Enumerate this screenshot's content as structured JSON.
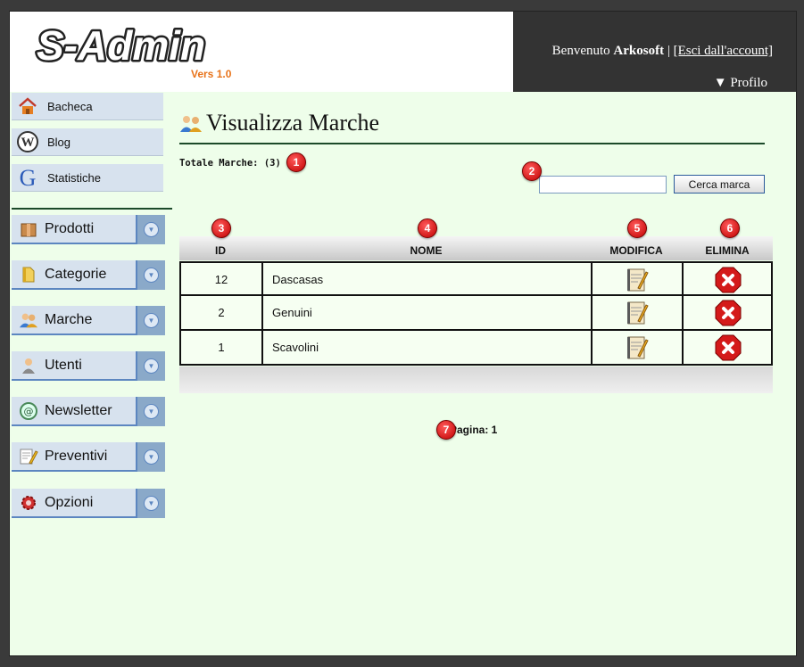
{
  "header": {
    "logo_text": "S-Admin",
    "logo_version": "Vers 1.0",
    "welcome_prefix": "Benvenuto",
    "username": "Arkosoft",
    "separator": "|",
    "logout_label": "[Esci dall'account]",
    "profile_label": "▼ Profilo"
  },
  "sidebar": {
    "quick_links": [
      {
        "label": "Bacheca",
        "icon": "home-icon"
      },
      {
        "label": "Blog",
        "icon": "wordpress-icon"
      },
      {
        "label": "Statistiche",
        "icon": "google-icon"
      }
    ],
    "menus": [
      {
        "label": "Prodotti",
        "icon": "box-icon"
      },
      {
        "label": "Categorie",
        "icon": "folder-icon"
      },
      {
        "label": "Marche",
        "icon": "users-icon"
      },
      {
        "label": "Utenti",
        "icon": "user-icon"
      },
      {
        "label": "Newsletter",
        "icon": "email-icon"
      },
      {
        "label": "Preventivi",
        "icon": "document-icon"
      },
      {
        "label": "Opzioni",
        "icon": "gear-icon"
      }
    ]
  },
  "main": {
    "title": "Visualizza Marche",
    "total_label": "Totale Marche: (3)",
    "search": {
      "value": "",
      "placeholder": ""
    },
    "search_button": "Cerca marca",
    "table": {
      "headers": {
        "id": "ID",
        "nome": "NOME",
        "modifica": "MODIFICA",
        "elimina": "ELIMINA"
      },
      "rows": [
        {
          "id": "12",
          "nome": "Dascasas"
        },
        {
          "id": "2",
          "nome": "Genuini"
        },
        {
          "id": "1",
          "nome": "Scavolini"
        }
      ]
    },
    "pager": "Pagina: 1"
  },
  "annotations": [
    "1",
    "2",
    "3",
    "4",
    "5",
    "6",
    "7"
  ],
  "colors": {
    "background": "#eefeea",
    "header_dark": "#333333",
    "menu_bg": "#d7e2ee",
    "menu_toggle": "#8aa9c9",
    "accent_line": "#1c4a2a",
    "badge_red": "#cc0000",
    "logo_orange": "#e8731a"
  }
}
